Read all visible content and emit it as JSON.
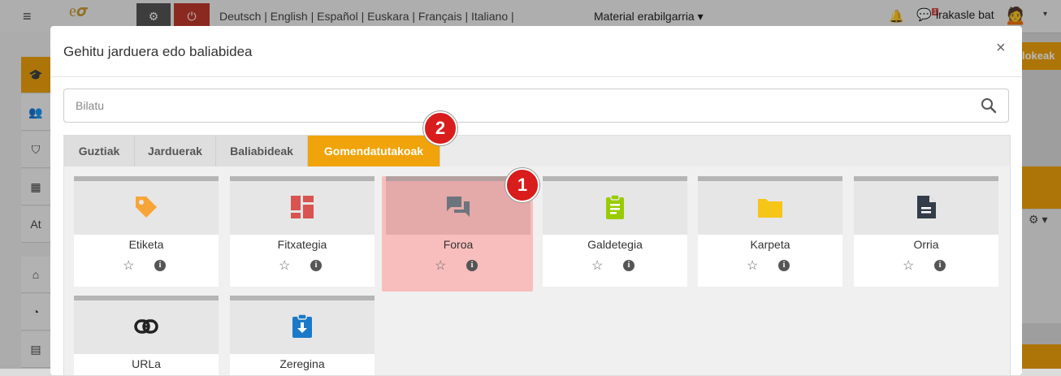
{
  "navbar": {
    "languages": "Deutsch | English | Español | Euskara | Français | Italiano |",
    "material_menu": "Material erabilgarria",
    "user_name": "irakasle bat",
    "message_count": "1"
  },
  "sidebar": {
    "partial_item": "At"
  },
  "background": {
    "right_button_partial": "lokeak"
  },
  "modal": {
    "title": "Gehitu jarduera edo baliabidea",
    "close_symbol": "×",
    "search_placeholder": "Bilatu",
    "tabs": [
      {
        "label": "Guztiak"
      },
      {
        "label": "Jarduerak"
      },
      {
        "label": "Baliabideak"
      },
      {
        "label": "Gomendatutakoak",
        "active": true
      }
    ],
    "items": [
      {
        "label": "Etiketa",
        "icon": "tag-icon",
        "color": "#f7a538"
      },
      {
        "label": "Fitxategia",
        "icon": "file-grid-icon",
        "color": "#d9534f"
      },
      {
        "label": "Foroa",
        "icon": "forum-icon",
        "color": "#6c757d",
        "highlighted": true
      },
      {
        "label": "Galdetegia",
        "icon": "quiz-clipboard-icon",
        "color": "#99cc00"
      },
      {
        "label": "Karpeta",
        "icon": "folder-icon",
        "color": "#f5c518"
      },
      {
        "label": "Orria",
        "icon": "page-icon",
        "color": "#333d4a"
      },
      {
        "label": "URLa",
        "icon": "link-icon",
        "color": "#222222"
      },
      {
        "label": "Zeregina",
        "icon": "assignment-icon",
        "color": "#1a7ac9"
      }
    ]
  },
  "annotations": [
    {
      "label": "1"
    },
    {
      "label": "2"
    }
  ],
  "colors": {
    "accent": "#f0a30a",
    "highlight": "#ffb3b3",
    "badge": "#d91c1c"
  }
}
